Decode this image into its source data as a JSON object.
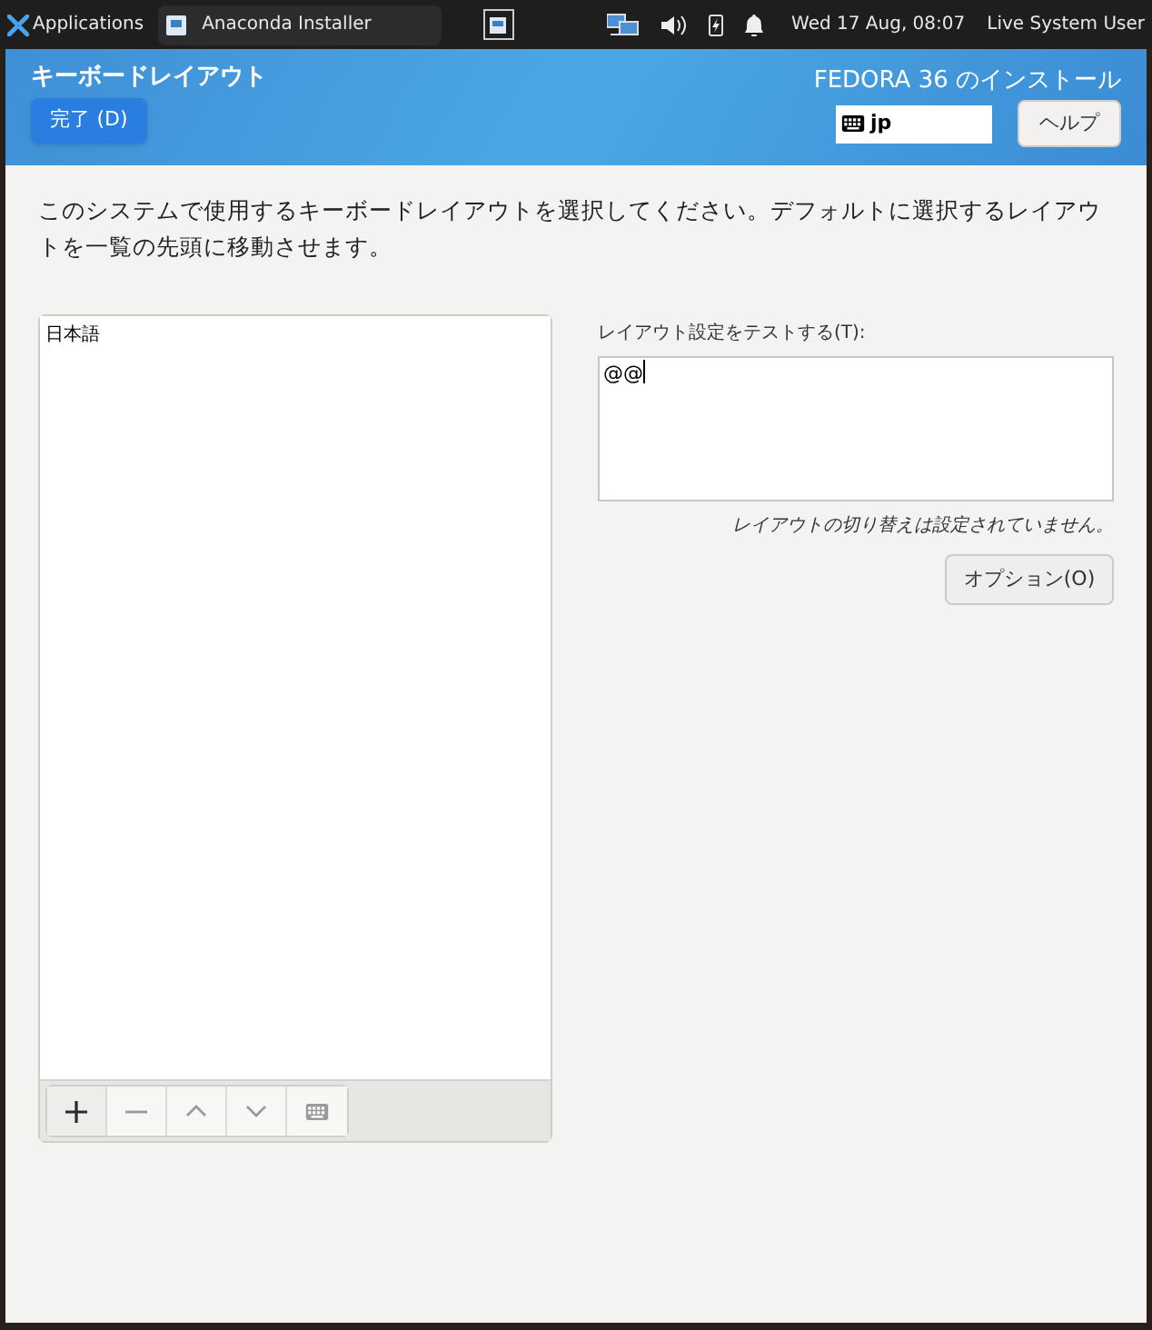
{
  "taskbar": {
    "apps_menu": "Applications",
    "task": "Anaconda Installer",
    "clock": "Wed 17 Aug, 08:07",
    "user": "Live System User"
  },
  "header": {
    "title": "キーボードレイアウト",
    "done_button": "完了 (D)",
    "product": "FEDORA 36 のインストール",
    "keyboard_indicator": "jp",
    "help_button": "ヘルプ"
  },
  "description": "このシステムで使用するキーボードレイアウトを選択してください。デフォルトに選択するレイアウトを一覧の先頭に移動させます。",
  "layouts": [
    {
      "label": "日本語",
      "selected": false
    }
  ],
  "toolbar": [
    {
      "kind": "add",
      "disabled": false
    },
    {
      "kind": "remove",
      "disabled": true
    },
    {
      "kind": "up",
      "disabled": true
    },
    {
      "kind": "down",
      "disabled": true
    },
    {
      "kind": "preview",
      "disabled": true
    }
  ],
  "test": {
    "label": "レイアウト設定をテストする(T):",
    "value": "@@"
  },
  "switch_note": "レイアウトの切り替えは設定されていません。",
  "options_button": "オプション(O)"
}
